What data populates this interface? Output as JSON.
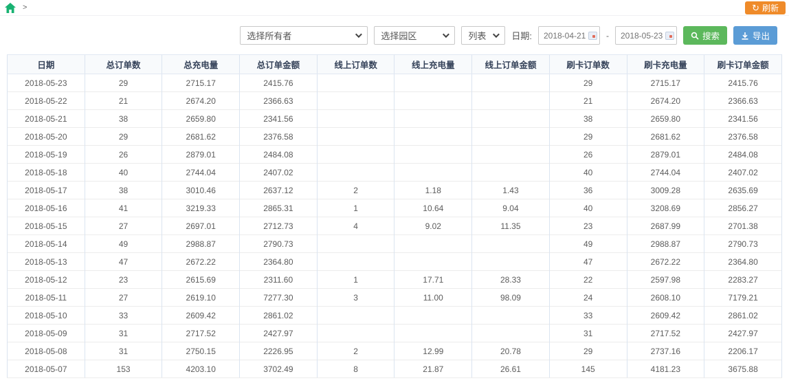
{
  "topbar": {
    "breadcrumb_separator": ">",
    "refresh_icon": "refresh-circular-arrow",
    "refresh_glyph": "↻",
    "refresh_label": "刷新"
  },
  "filters": {
    "owner_select_value": "选择所有者",
    "park_select_value": "选择园区",
    "view_select_value": "列表",
    "date_label": "日期:",
    "date_from": "2018-04-21",
    "date_separator": "-",
    "date_to": "2018-05-23",
    "search_label": "搜索",
    "export_label": "导出"
  },
  "colors": {
    "home_icon": "#18b272",
    "refresh_button": "#ef8b2a",
    "search_button": "#5cb85c",
    "export_button": "#5b9cd6",
    "header_text": "#36435a",
    "grid_vertical_border": "#dbe4f0",
    "grid_horizontal_border": "#ececec"
  },
  "table": {
    "headers": [
      "日期",
      "总订单数",
      "总充电量",
      "总订单金额",
      "线上订单数",
      "线上充电量",
      "线上订单金额",
      "刷卡订单数",
      "刷卡充电量",
      "刷卡订单金额"
    ],
    "rows": [
      [
        "2018-05-23",
        "29",
        "2715.17",
        "2415.76",
        "",
        "",
        "",
        "29",
        "2715.17",
        "2415.76"
      ],
      [
        "2018-05-22",
        "21",
        "2674.20",
        "2366.63",
        "",
        "",
        "",
        "21",
        "2674.20",
        "2366.63"
      ],
      [
        "2018-05-21",
        "38",
        "2659.80",
        "2341.56",
        "",
        "",
        "",
        "38",
        "2659.80",
        "2341.56"
      ],
      [
        "2018-05-20",
        "29",
        "2681.62",
        "2376.58",
        "",
        "",
        "",
        "29",
        "2681.62",
        "2376.58"
      ],
      [
        "2018-05-19",
        "26",
        "2879.01",
        "2484.08",
        "",
        "",
        "",
        "26",
        "2879.01",
        "2484.08"
      ],
      [
        "2018-05-18",
        "40",
        "2744.04",
        "2407.02",
        "",
        "",
        "",
        "40",
        "2744.04",
        "2407.02"
      ],
      [
        "2018-05-17",
        "38",
        "3010.46",
        "2637.12",
        "2",
        "1.18",
        "1.43",
        "36",
        "3009.28",
        "2635.69"
      ],
      [
        "2018-05-16",
        "41",
        "3219.33",
        "2865.31",
        "1",
        "10.64",
        "9.04",
        "40",
        "3208.69",
        "2856.27"
      ],
      [
        "2018-05-15",
        "27",
        "2697.01",
        "2712.73",
        "4",
        "9.02",
        "11.35",
        "23",
        "2687.99",
        "2701.38"
      ],
      [
        "2018-05-14",
        "49",
        "2988.87",
        "2790.73",
        "",
        "",
        "",
        "49",
        "2988.87",
        "2790.73"
      ],
      [
        "2018-05-13",
        "47",
        "2672.22",
        "2364.80",
        "",
        "",
        "",
        "47",
        "2672.22",
        "2364.80"
      ],
      [
        "2018-05-12",
        "23",
        "2615.69",
        "2311.60",
        "1",
        "17.71",
        "28.33",
        "22",
        "2597.98",
        "2283.27"
      ],
      [
        "2018-05-11",
        "27",
        "2619.10",
        "7277.30",
        "3",
        "11.00",
        "98.09",
        "24",
        "2608.10",
        "7179.21"
      ],
      [
        "2018-05-10",
        "33",
        "2609.42",
        "2861.02",
        "",
        "",
        "",
        "33",
        "2609.42",
        "2861.02"
      ],
      [
        "2018-05-09",
        "31",
        "2717.52",
        "2427.97",
        "",
        "",
        "",
        "31",
        "2717.52",
        "2427.97"
      ],
      [
        "2018-05-08",
        "31",
        "2750.15",
        "2226.95",
        "2",
        "12.99",
        "20.78",
        "29",
        "2737.16",
        "2206.17"
      ],
      [
        "2018-05-07",
        "153",
        "4203.10",
        "3702.49",
        "8",
        "21.87",
        "26.61",
        "145",
        "4181.23",
        "3675.88"
      ]
    ]
  }
}
